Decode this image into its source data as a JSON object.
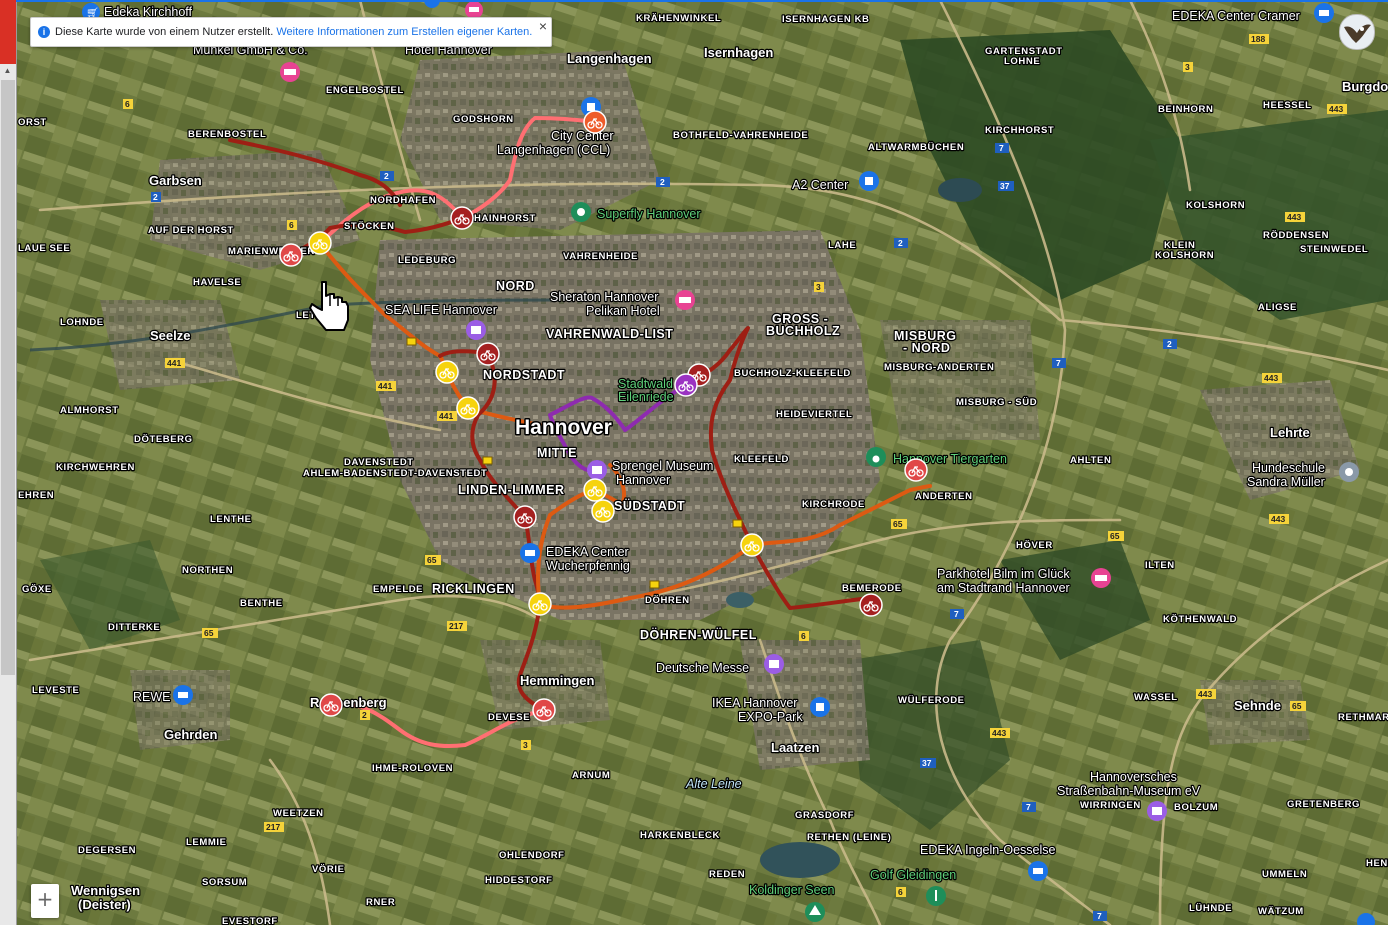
{
  "notice": {
    "text": "Diese Karte wurde von einem Nutzer erstellt.",
    "link": "Weitere Informationen zum Erstellen eigener Karten.",
    "close": "×"
  },
  "zoom": {
    "plus": "+"
  },
  "colors": {
    "route_dark_red": "#9e1f14",
    "route_red": "#c0342a",
    "route_orange": "#dd5a12",
    "route_pink": "#ff6f72",
    "route_purple": "#8e2bb0",
    "marker_yellow": "#f6d30e",
    "marker_red": "#e04848",
    "marker_darkred": "#a52020",
    "marker_orange": "#ee5c2a",
    "marker_purple": "#9b33c2"
  },
  "map": {
    "city": "Hannover",
    "districts": [
      "KRÄHENWINKEL",
      "ISERNHAGEN KB",
      "GARTENSTADT",
      "LOHNE",
      "ENGELBOSTEL",
      "BERENBOSTEL",
      "GODSHORN",
      "BOTHFELD-VAHRENHEIDE",
      "ALTWARMBÜCHEN",
      "KIRCHHORST",
      "BEINHORN",
      "HEESSEL",
      "NORDHAFEN",
      "AUF DER HORST",
      "STÖCKEN",
      "HAINHORST",
      "MARIENWERDER",
      "HAVELSE",
      "LEDEBURG",
      "VAHRENHEIDE",
      "LOHNDE",
      "NORD",
      "GROSS -",
      "BUCHHOLZ",
      "MISBURG",
      "- NORD",
      "VAHRENWALD-LIST",
      "MISBURG-ANDERTEN",
      "BUCHHOLZ-KLEEFELD",
      "MISBURG - SÜD",
      "HEIDEVIERTEL",
      "NORDSTADT",
      "ALMHORST",
      "DÖTEBERG",
      "KIRCHWEHREN",
      "DAVENSTEDT",
      "AHLEM-BADENSTEDT-DAVENSTEDT",
      "MITTE",
      "KLEEFELD",
      "AHLTEN",
      "LINDEN-LIMMER",
      "SÜDSTADT",
      "ANDERTEN",
      "KIRCHRODE",
      "LENTHE",
      "HÖVER",
      "NORTHEN",
      "EMPELDE",
      "RICKLINGEN",
      "BEMERODE",
      "ILTEN",
      "GÖXE",
      "BENTHE",
      "DÖHREN",
      "DITTERKE",
      "DÖHREN-WÜLFEL",
      "KÖTHENWALD",
      "LEVESTE",
      "DEVESE",
      "WÜLFERODE",
      "WASSEL",
      "RETHMAR",
      "IHME-ROLOVEN",
      "ARNUM",
      "WIRRINGEN",
      "BOLZUM",
      "GRETENBERG",
      "WEETZEN",
      "GRASDORF",
      "LEMMIE",
      "DEGERSEN",
      "HARKENBLECK",
      "RETHEN (LEINE)",
      "OHLENDORF",
      "VÖRIE",
      "SORSUM",
      "HIDDESTORF",
      "REDEN",
      "UMMELN",
      "LÜHNDE",
      "EVESTORF",
      "WÄTZUM",
      "KOLSHORN",
      "RÖDDENSEN",
      "STEINWEDEL",
      "KLEIN",
      "KOLSHORN",
      "ALIGSE",
      "EHRENHORST",
      "ORST",
      "HENRENS",
      "LAUE SEE"
    ],
    "towns": [
      "Langenhagen",
      "Isernhagen",
      "Burgdo",
      "Garbsen",
      "Seelze",
      "Lehrte",
      "Sehnde",
      "Gehrden",
      "Hemmingen",
      "Laatzen",
      "Ronnenberg",
      "Wennigsen",
      "(Deister)"
    ],
    "pois": [
      "Edeka Kirchhoff",
      "Munkel GmbH & Co.",
      "Hotel Hannover",
      "EDEKA Center Cramer",
      "City Center",
      "Langenhagen (CCL)",
      "Superfly Hannover",
      "A2 Center",
      "SEA LIFE Hannover",
      "Sheraton Hannover",
      "Pelikan Hotel",
      "Stadtwald",
      "Eilenriede",
      "Sprengel Museum",
      "Hannover",
      "Hannover Tiergarten",
      "Hundeschule",
      "Sandra Müller",
      "EDEKA Center",
      "Wucherpfennig",
      "Parkhotel Bilm im Glück",
      "am Stadtrand Hannover",
      "Deutsche Messe",
      "IKEA Hannover",
      "EXPO-Park",
      "REWE",
      "Hannoversches",
      "Straßenbahn-Museum eV",
      "EDEKA Ingeln-Oesselse",
      "Golf Gleidingen",
      "Koldinger Seen",
      "Alte Leine"
    ],
    "road_numbers": [
      "6",
      "2",
      "2",
      "2",
      "7",
      "37",
      "2",
      "3",
      "188",
      "443",
      "441",
      "441",
      "65",
      "217",
      "6",
      "37",
      "7",
      "443",
      "65",
      "3",
      "217",
      "443",
      "65",
      "6",
      "7",
      "443",
      "7"
    ]
  }
}
